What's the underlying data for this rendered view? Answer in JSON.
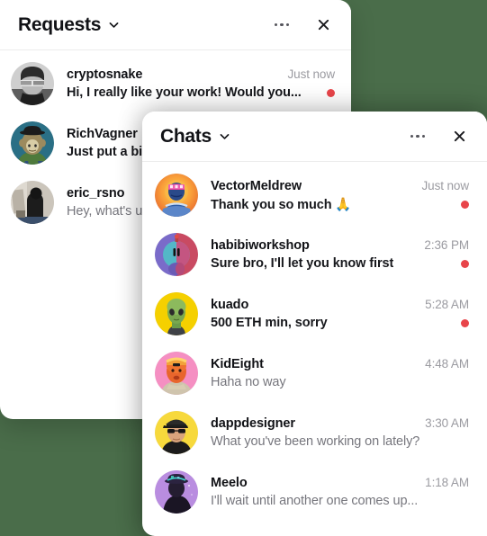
{
  "theme": {
    "background": "#4a6d4a",
    "panel_bg": "#ffffff",
    "text_primary": "#111216",
    "text_muted": "#9b9ba1",
    "text_read": "#76767d",
    "unread_dot": "#e8454a"
  },
  "panels": [
    {
      "id": "requests",
      "title": "Requests",
      "icons": {
        "chevron": "chevron-down-icon",
        "more": "more-options-icon",
        "close": "close-icon"
      },
      "rows": [
        {
          "avatar": "cryptosnake-avatar",
          "username": "cryptosnake",
          "timestamp": "Just now",
          "message": "Hi, I really like your work! Would you...",
          "unread": true
        },
        {
          "avatar": "richvagner-avatar",
          "username": "RichVagner",
          "timestamp": "",
          "message": "Just put a bid",
          "unread": false
        },
        {
          "avatar": "eric-rsno-avatar",
          "username": "eric_rsno",
          "timestamp": "",
          "message": "Hey, what's up",
          "unread": false
        }
      ]
    },
    {
      "id": "chats",
      "title": "Chats",
      "icons": {
        "chevron": "chevron-down-icon",
        "more": "more-options-icon",
        "close": "close-icon"
      },
      "rows": [
        {
          "avatar": "vectormeldrew-avatar",
          "username": "VectorMeldrew",
          "timestamp": "Just now",
          "message": "Thank you so much 🙏",
          "unread": true
        },
        {
          "avatar": "habibiworkshop-avatar",
          "username": "habibiworkshop",
          "timestamp": "2:36 PM",
          "message": "Sure bro, I'll let you know first",
          "unread": true
        },
        {
          "avatar": "kuado-avatar",
          "username": "kuado",
          "timestamp": "5:28 AM",
          "message": "500 ETH min, sorry",
          "unread": true
        },
        {
          "avatar": "kideight-avatar",
          "username": "KidEight",
          "timestamp": "4:48 AM",
          "message": "Haha no way",
          "unread": false
        },
        {
          "avatar": "dappdesigner-avatar",
          "username": "dappdesigner",
          "timestamp": "3:30 AM",
          "message": "What you've been working on lately?",
          "unread": false
        },
        {
          "avatar": "meelo-avatar",
          "username": "Meelo",
          "timestamp": "1:18 AM",
          "message": "I'll wait until another one comes up...",
          "unread": false
        }
      ]
    }
  ]
}
